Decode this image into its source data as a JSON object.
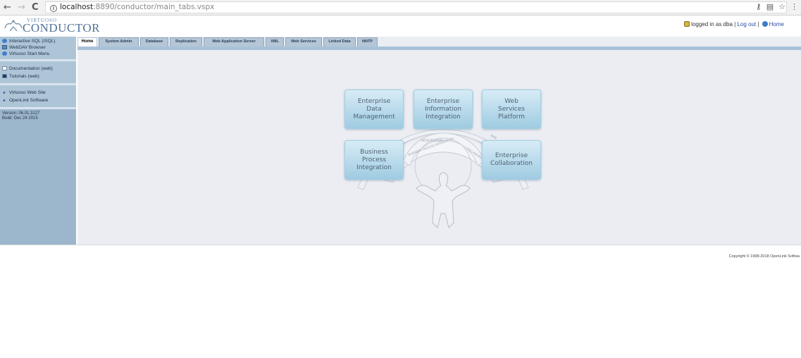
{
  "browser": {
    "url_host": "localhost",
    "url_path": ":8890/conductor/main_tabs.vspx",
    "back_icon": "←",
    "forward_icon": "→",
    "reload_icon": "C"
  },
  "header": {
    "logo_small": "VIRTUOSO",
    "logo_big": "CONDUCTOR",
    "logged_in_text": "logged in as dba | ",
    "logout_label": "Log out",
    "separator": " | ",
    "home_label": "Home"
  },
  "sidebar": {
    "group1": [
      {
        "label": "Interactive SQL (ISQL)",
        "icon": "sql-icon"
      },
      {
        "label": "WebDAV Browser",
        "icon": "webdav-icon"
      },
      {
        "label": "Virtuoso Start Menu",
        "icon": "start-menu-icon"
      }
    ],
    "group2": [
      {
        "label": "Documentation (web)",
        "icon": "documentation-icon"
      },
      {
        "label": "Tutorials (web)",
        "icon": "tutorials-icon"
      }
    ],
    "group3": [
      {
        "label": "Virtuoso Web Site",
        "icon": "website-icon"
      },
      {
        "label": "OpenLink Software",
        "icon": "openlink-icon"
      }
    ],
    "version_line": "Version: 06.01.3127",
    "build_line": "Build: Dec 24 2015"
  },
  "tabs": [
    "Home",
    "System Admin",
    "Database",
    "Replication",
    "Web Application Server",
    "XML",
    "Web Services",
    "Linked Data",
    "NNTP"
  ],
  "diagram": {
    "boxes": [
      {
        "lines": [
          "Enterprise",
          "Data",
          "Management"
        ]
      },
      {
        "lines": [
          "Enterprise",
          "Information",
          "Integration"
        ]
      },
      {
        "lines": [
          "Web",
          "Services",
          "Platform"
        ]
      },
      {
        "lines": [
          "Business",
          "Process",
          "Integration"
        ]
      },
      {
        "lines": [
          "Enterprise",
          "Collaboration"
        ]
      }
    ],
    "arc_labels": [
      "BUSINESS PROCESS INTEGRATION",
      "COLLABORATION",
      "INTEGRATION",
      "WEB"
    ]
  },
  "footer": {
    "copyright": "Copyright © 1998-2018 OpenLink Softwa"
  }
}
